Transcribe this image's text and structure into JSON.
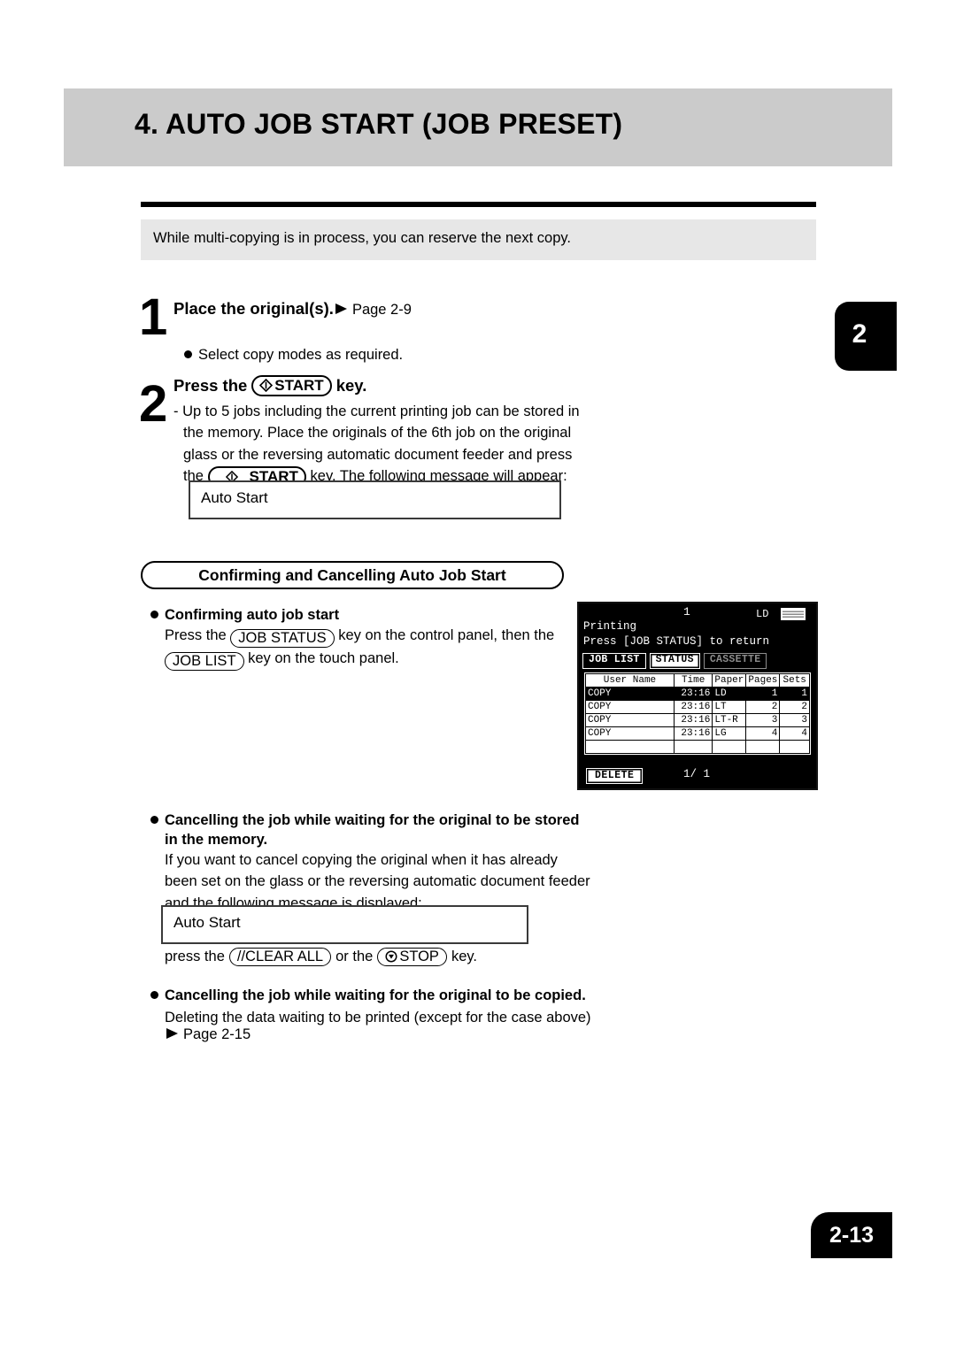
{
  "header": {
    "title": "4. AUTO JOB START (JOB PRESET)",
    "chapter_tab": "2"
  },
  "intro": {
    "text": "While multi-copying is in process, you can reserve the next copy."
  },
  "steps": [
    {
      "number": "1",
      "heading": "Place the original(s).",
      "page_ref": "Page 2-9",
      "bullet": "Select copy modes as required."
    },
    {
      "number": "2",
      "heading_before": "Press the",
      "key_label": "START",
      "heading_after": "key.",
      "lines": [
        "- Up to 5 jobs including the current printing job can be stored in",
        "the memory. Place the originals of the 6th job on the original",
        "glass or the reversing automatic document feeder and press"
      ],
      "last_line_before": "the",
      "last_line_key": "START",
      "last_line_after": "key. The following message will appear:",
      "message_box": "Auto Start"
    }
  ],
  "section": {
    "title": "Confirming and Cancelling Auto Job Start"
  },
  "subsections": [
    {
      "heading": "Confirming auto job start",
      "line1_before": "Press the",
      "line1_key": "JOB STATUS",
      "line1_after": "key on the control panel, then the",
      "line2_key": "JOB LIST",
      "line2_after": "key on the touch panel."
    },
    {
      "heading_line1": "Cancelling the job while waiting for the original to be stored",
      "heading_line2": "in the memory.",
      "lines": [
        "If you want to cancel copying the original when it has already",
        "been set on the glass or the reversing automatic document feeder",
        "and the following message is displayed:"
      ],
      "message_box": "Auto Start",
      "after_before": "press the",
      "after_key1": "//CLEAR ALL",
      "after_mid": "or the",
      "after_key2": "STOP",
      "after_end": "key."
    },
    {
      "heading": "Cancelling the job while waiting for the original to be  copied.",
      "line1": "Deleting the data waiting to be printed (except for the case  above)",
      "page_ref": "Page 2-15"
    }
  ],
  "lcd": {
    "count": "1",
    "paper_label": "LD",
    "stack_icon": "paper-stack-icon",
    "status": "Printing",
    "hint": "Press [JOB STATUS] to return",
    "tabs": [
      {
        "label": "JOB LIST",
        "state": "selected"
      },
      {
        "label": "STATUS",
        "state": "normal"
      },
      {
        "label": "CASSETTE",
        "state": "disabled"
      }
    ],
    "columns": [
      "User Name",
      "Time",
      "Paper",
      "Pages",
      "Sets"
    ],
    "rows": [
      {
        "user": "COPY",
        "time": "23:16",
        "paper": "LD",
        "pages": "1",
        "sets": "1",
        "selected": true
      },
      {
        "user": "COPY",
        "time": "23:16",
        "paper": "LT",
        "pages": "2",
        "sets": "2",
        "selected": false
      },
      {
        "user": "COPY",
        "time": "23:16",
        "paper": "LT-R",
        "pages": "3",
        "sets": "3",
        "selected": false
      },
      {
        "user": "COPY",
        "time": "23:16",
        "paper": "LG",
        "pages": "4",
        "sets": "4",
        "selected": false
      }
    ],
    "delete_label": "DELETE",
    "page_indicator": "1/ 1"
  },
  "footer": {
    "page_number": "2-13"
  },
  "colors": {
    "title_band": "#cbcbcb",
    "intro_band": "#e7e7e7",
    "ink": "#000000",
    "lcd_background": "#000000",
    "lcd_foreground": "#ffffff"
  }
}
